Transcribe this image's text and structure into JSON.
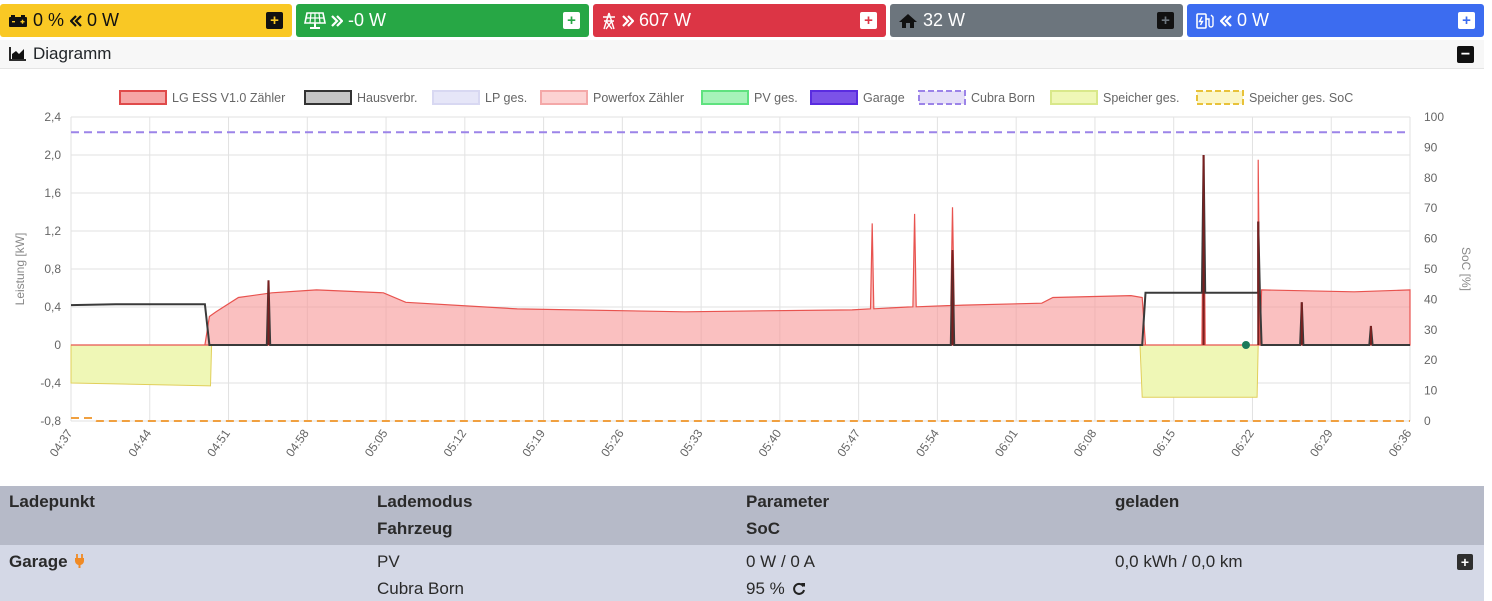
{
  "tiles": {
    "battery": {
      "value": "0 %",
      "power": "0 W",
      "color": "#f9c824",
      "icon": "battery-icon"
    },
    "pv": {
      "value": "-0 W",
      "color": "#27a745",
      "icon": "solar-panel-icon"
    },
    "grid": {
      "value": "607 W",
      "color": "#dc3545",
      "icon": "power-tower-icon"
    },
    "house": {
      "value": "32 W",
      "color": "#6c757d",
      "icon": "home-icon"
    },
    "ev": {
      "value": "0 W",
      "color": "#3c6cf0",
      "icon": "charging-station-icon"
    }
  },
  "diagram": {
    "title": "Diagramm"
  },
  "chart_data": {
    "type": "line",
    "legend": [
      {
        "name": "LG ESS V1.0 Zähler",
        "fill": "#f6a5a5",
        "stroke": "#e04a4a",
        "dashed": false
      },
      {
        "name": "Hausverbr.",
        "fill": "#c4c4c4",
        "stroke": "#333333",
        "dashed": false
      },
      {
        "name": "LP ges.",
        "fill": "#e6e6f8",
        "stroke": "#d8d8f2",
        "dashed": false
      },
      {
        "name": "Powerfox Zähler",
        "fill": "#fcd2d2",
        "stroke": "#f4a8a8",
        "dashed": false
      },
      {
        "name": "PV ges.",
        "fill": "#a6f3b9",
        "stroke": "#5fe27f",
        "dashed": false
      },
      {
        "name": "Garage",
        "fill": "#7b52e8",
        "stroke": "#5a2ce0",
        "dashed": false
      },
      {
        "name": "Cubra Born",
        "fill": "#e6e0f8",
        "stroke": "#9c84e8",
        "dashed": true
      },
      {
        "name": "Speicher ges.",
        "fill": "#eff7b6",
        "stroke": "#d9e88a",
        "dashed": false
      },
      {
        "name": "Speicher ges. SoC",
        "fill": "#fbf6c8",
        "stroke": "#e8c23a",
        "dashed": true
      }
    ],
    "ylabel": "Leistung [kW]",
    "y2label": "SoC [%]",
    "ylim": [
      -0.8,
      2.4
    ],
    "y2lim": [
      0,
      100
    ],
    "yticks": [
      "2,4",
      "2,0",
      "1,6",
      "1,2",
      "0,8",
      "0,4",
      "0",
      "-0,4",
      "-0,8"
    ],
    "y2ticks": [
      "100",
      "90",
      "80",
      "70",
      "60",
      "50",
      "40",
      "30",
      "20",
      "10",
      "0"
    ],
    "xticks": [
      "04:37",
      "04:44",
      "04:51",
      "04:58",
      "05:05",
      "05:12",
      "05:19",
      "05:26",
      "05:33",
      "05:40",
      "05:47",
      "05:54",
      "06:01",
      "06:08",
      "06:15",
      "06:22",
      "06:29",
      "06:36"
    ],
    "x_minutes_range": [
      0,
      120
    ],
    "series": [
      {
        "name": "LG ESS V1.0 Zähler",
        "unit": "kW",
        "points": [
          [
            0,
            0
          ],
          [
            12,
            0
          ],
          [
            12.4,
            0.3
          ],
          [
            13,
            0.35
          ],
          [
            15,
            0.5
          ],
          [
            18,
            0.55
          ],
          [
            22,
            0.58
          ],
          [
            28,
            0.55
          ],
          [
            30,
            0.45
          ],
          [
            40,
            0.38
          ],
          [
            55,
            0.35
          ],
          [
            62,
            0.36
          ],
          [
            70,
            0.37
          ],
          [
            75,
            0.4
          ],
          [
            80,
            0.42
          ],
          [
            87,
            0.44
          ],
          [
            88,
            0.5
          ],
          [
            95,
            0.52
          ],
          [
            96,
            0.5
          ],
          [
            96.3,
            0
          ],
          [
            96.5,
            0
          ],
          [
            106.4,
            0
          ],
          [
            106.7,
            0.58
          ],
          [
            115,
            0.56
          ],
          [
            120,
            0.58
          ]
        ],
        "spikes": [
          [
            71.8,
            1.28
          ],
          [
            75.6,
            1.38
          ],
          [
            79,
            1.45
          ],
          [
            101.5,
            2.0
          ],
          [
            106.4,
            1.95
          ]
        ]
      },
      {
        "name": "Hausverbr.",
        "unit": "kW",
        "points": [
          [
            0,
            0.42
          ],
          [
            4,
            0.43
          ],
          [
            12,
            0.43
          ],
          [
            12.4,
            0
          ],
          [
            96,
            0
          ],
          [
            96.3,
            0.55
          ],
          [
            106.4,
            0.55
          ],
          [
            106.7,
            0
          ],
          [
            120,
            0
          ]
        ],
        "spikes": [
          [
            17.7,
            0.68
          ],
          [
            79,
            1.0
          ],
          [
            101.5,
            2.0
          ],
          [
            106.4,
            1.3
          ],
          [
            110.3,
            0.45
          ],
          [
            116.5,
            0.2
          ]
        ]
      },
      {
        "name": "Speicher ges.",
        "unit": "kW",
        "points": [
          [
            0,
            -0.4
          ],
          [
            12.5,
            -0.43
          ],
          [
            12.6,
            0
          ],
          [
            95.8,
            0
          ],
          [
            96,
            -0.55
          ],
          [
            106.3,
            -0.55
          ],
          [
            106.4,
            0
          ],
          [
            120,
            0
          ]
        ]
      },
      {
        "name": "Cubra Born",
        "unit": "%",
        "points": [
          [
            0,
            95
          ],
          [
            120,
            95
          ]
        ]
      },
      {
        "name": "Speicher ges. SoC",
        "unit": "%",
        "points": [
          [
            0,
            1
          ],
          [
            2,
            1
          ],
          [
            2.3,
            0
          ],
          [
            120,
            0
          ]
        ]
      }
    ]
  },
  "table": {
    "headers": {
      "ladepunkt": "Ladepunkt",
      "lademodus": "Lademodus",
      "fahrzeug": "Fahrzeug",
      "parameter": "Parameter",
      "soc": "SoC",
      "geladen": "geladen"
    },
    "rows": [
      {
        "ladepunkt": "Garage",
        "lademodus": "PV",
        "fahrzeug": "Cubra Born",
        "parameter": "0 W / 0 A",
        "soc": "95 %",
        "geladen": "0,0 kWh / 0,0 km"
      }
    ]
  }
}
